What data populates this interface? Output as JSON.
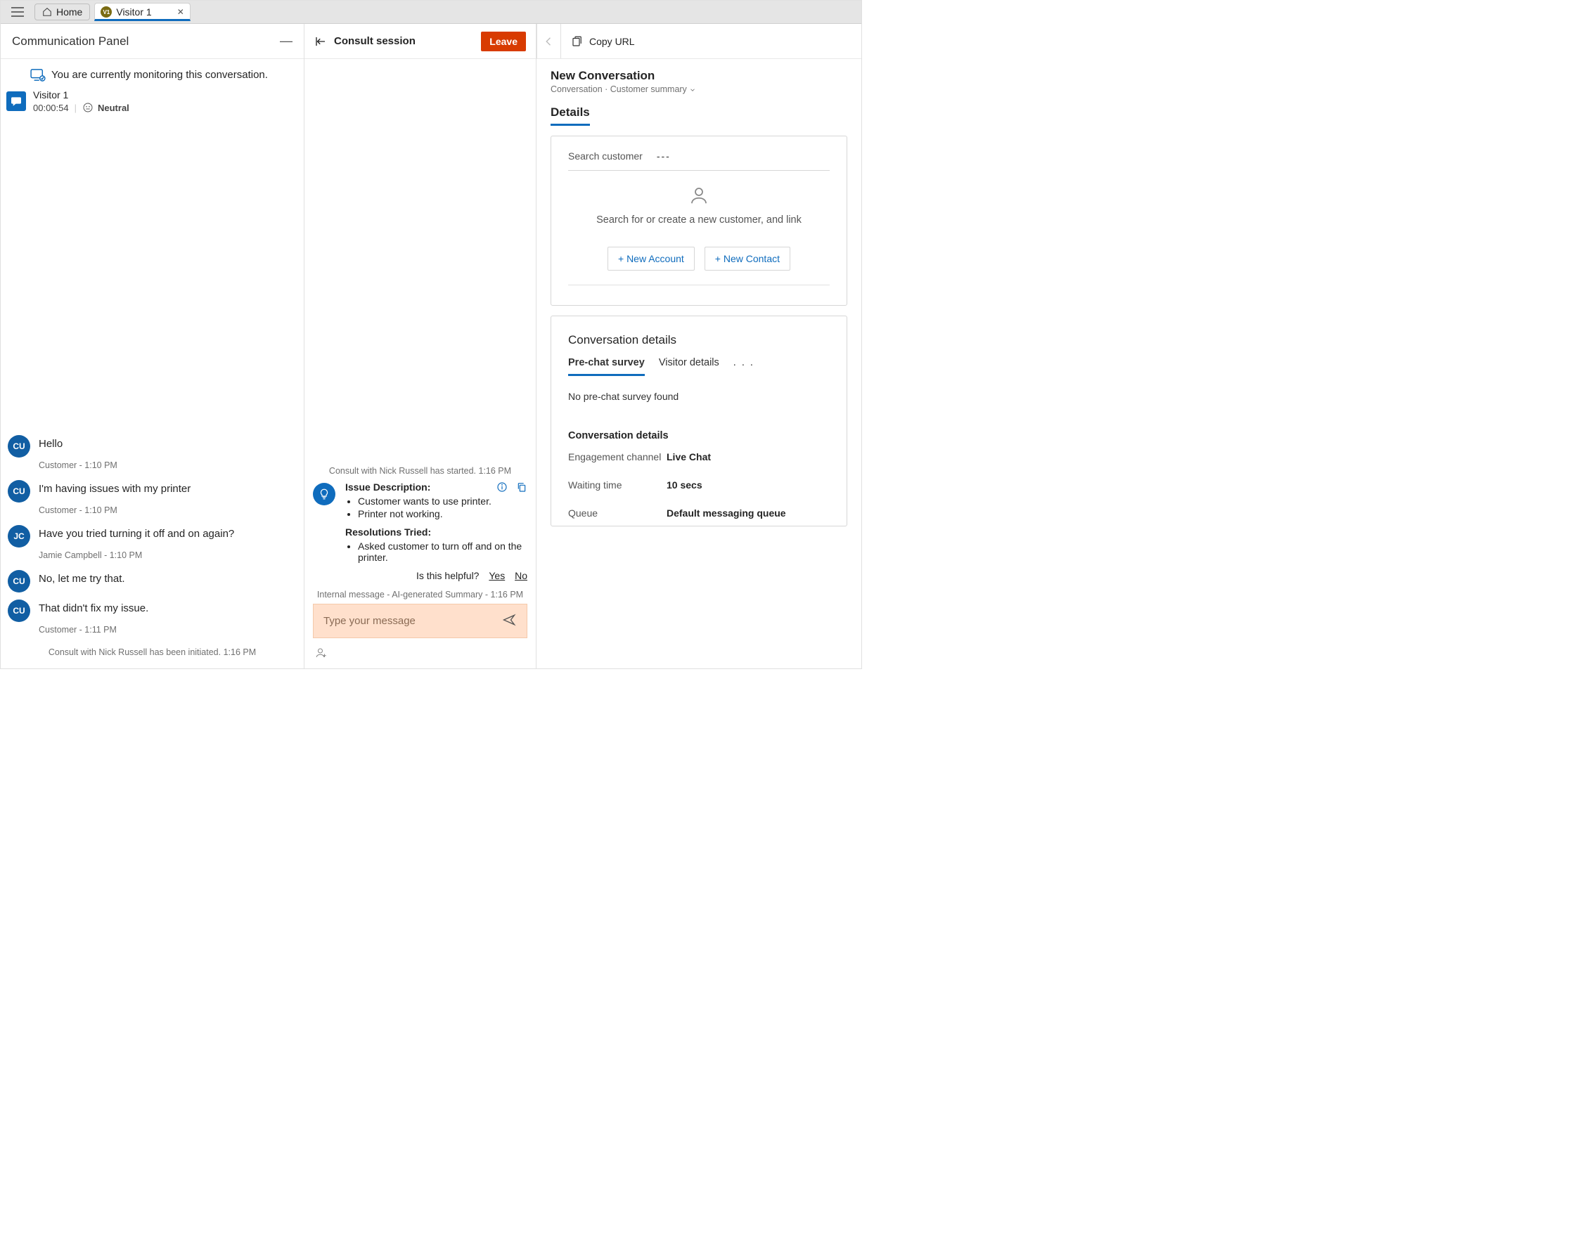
{
  "topbar": {
    "home_label": "Home",
    "tab": {
      "label": "Visitor 1",
      "avatar": "V1"
    }
  },
  "left": {
    "panel_title": "Communication Panel",
    "monitor_banner": "You are currently monitoring this conversation.",
    "visitor": {
      "name": "Visitor 1",
      "timer": "00:00:54",
      "sentiment": "Neutral"
    },
    "messages": [
      {
        "avatar": "CU",
        "who": "cu",
        "text": "Hello",
        "meta": "Customer - 1:10 PM"
      },
      {
        "avatar": "CU",
        "who": "cu",
        "text": "I'm having issues with my printer",
        "meta": "Customer - 1:10 PM"
      },
      {
        "avatar": "JC",
        "who": "jc",
        "text": "Have you tried turning it off and on again?",
        "meta": "Jamie Campbell - 1:10 PM"
      },
      {
        "avatar": "CU",
        "who": "cu",
        "text": "No, let me try that.",
        "meta": ""
      },
      {
        "avatar": "CU",
        "who": "cu",
        "text": "That didn't fix my issue.",
        "meta": "Customer - 1:11 PM"
      }
    ],
    "system_note": "Consult with Nick Russell has been initiated. 1:16 PM"
  },
  "mid": {
    "title": "Consult session",
    "leave": "Leave",
    "consult_start": "Consult with Nick Russell has started. 1:16 PM",
    "issue_h": "Issue Description:",
    "issue_items": [
      "Customer wants to use printer.",
      "Printer not working."
    ],
    "res_h": "Resolutions Tried:",
    "res_items": [
      "Asked customer to turn off and on the printer."
    ],
    "helpful_q": "Is this helpful?",
    "yes": "Yes",
    "no": "No",
    "internal_meta": "Internal message - AI-generated Summary - 1:16 PM",
    "placeholder": "Type your message"
  },
  "right": {
    "copy_label": "Copy URL",
    "title": "New Conversation",
    "subtitle_a": "Conversation",
    "subtitle_b": "Customer summary",
    "section": "Details",
    "search_label": "Search customer",
    "search_value": "---",
    "empty_hint": "Search for or create a new customer, and link",
    "new_account": "+ New Account",
    "new_contact": "+ New Contact",
    "conv_title": "Conversation details",
    "tabs": {
      "a": "Pre-chat survey",
      "b": "Visitor details",
      "more": ". . ."
    },
    "no_survey": "No pre-chat survey found",
    "kv_title": "Conversation details",
    "kv": [
      {
        "k": "Engagement channel",
        "v": "Live Chat"
      },
      {
        "k": "Waiting time",
        "v": "10 secs"
      },
      {
        "k": "Queue",
        "v": "Default messaging queue"
      }
    ]
  }
}
